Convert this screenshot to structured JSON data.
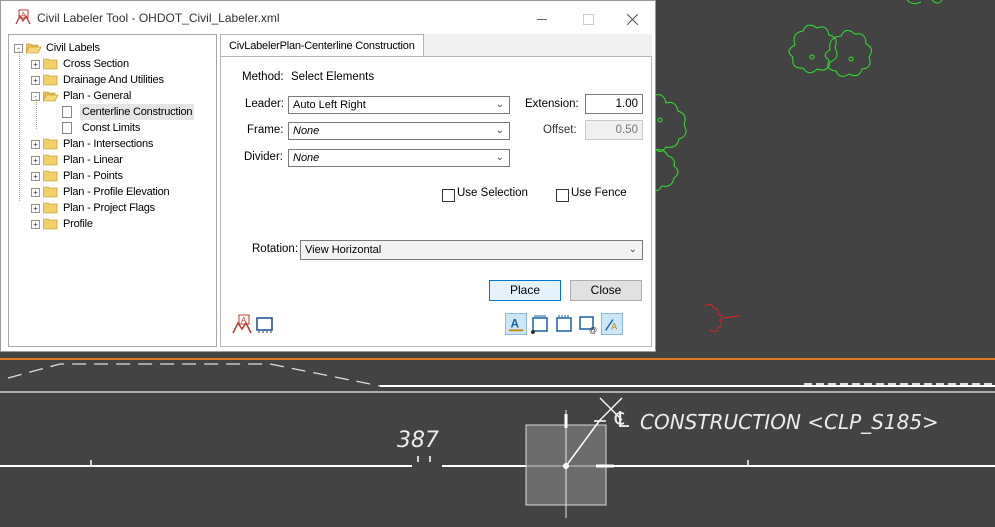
{
  "window": {
    "title": "Civil Labeler Tool - OHDOT_Civil_Labeler.xml",
    "minimize_icon": "minimize-icon",
    "maximize_icon": "maximize-icon",
    "close_icon": "close-icon"
  },
  "tree": {
    "root": "Civil Labels",
    "items": [
      {
        "label": "Cross Section",
        "type": "folder"
      },
      {
        "label": "Drainage And Utilities",
        "type": "folder"
      },
      {
        "label": "Plan - General",
        "type": "folder-open"
      },
      {
        "label": "Centerline Construction",
        "type": "leaf",
        "selected": true
      },
      {
        "label": "Const Limits",
        "type": "leaf"
      },
      {
        "label": "Plan - Intersections",
        "type": "folder"
      },
      {
        "label": "Plan - Linear",
        "type": "folder"
      },
      {
        "label": "Plan - Points",
        "type": "folder"
      },
      {
        "label": "Plan - Profile Elevation",
        "type": "folder"
      },
      {
        "label": "Plan - Project Flags",
        "type": "folder"
      },
      {
        "label": "Profile",
        "type": "folder"
      }
    ]
  },
  "panel": {
    "tab": "CivLabelerPlan-Centerline Construction",
    "method_label": "Method:",
    "method_value": "Select Elements",
    "leader_label": "Leader:",
    "leader_value": "Auto Left Right",
    "frame_label": "Frame:",
    "frame_value": "None",
    "divider_label": "Divider:",
    "divider_value": "None",
    "extension_label": "Extension:",
    "extension_value": "1.00",
    "offset_label": "Offset:",
    "offset_value": "0.50",
    "use_selection": "Use Selection",
    "use_fence": "Use Fence",
    "rotation_label": "Rotation:",
    "rotation_value": "View Horizontal",
    "place_button": "Place",
    "close_button": "Close"
  },
  "cad": {
    "station_label": "387",
    "centerline_label": "CONSTRUCTION <CLP_S185>",
    "centerline_symbol": "℄",
    "colors": {
      "background": "#434343",
      "trees": "#2ee32e",
      "orange_line": "#e07a1e",
      "red_symbol": "#e02020"
    }
  }
}
